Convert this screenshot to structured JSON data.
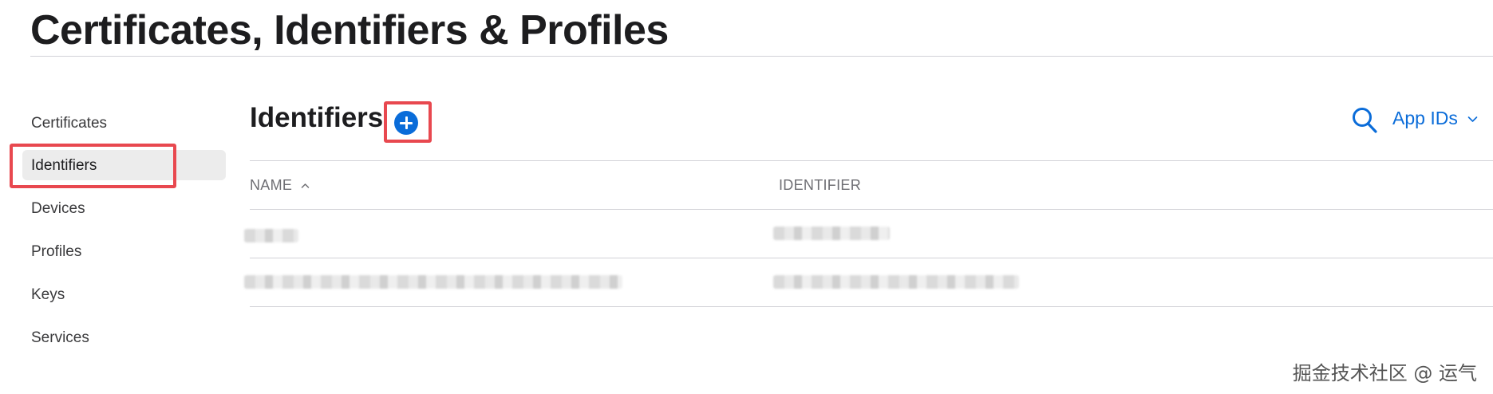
{
  "header": {
    "title": "Certificates, Identifiers & Profiles"
  },
  "sidebar": {
    "items": [
      {
        "label": "Certificates",
        "active": false
      },
      {
        "label": "Identifiers",
        "active": true
      },
      {
        "label": "Devices",
        "active": false
      },
      {
        "label": "Profiles",
        "active": false
      },
      {
        "label": "Keys",
        "active": false
      },
      {
        "label": "Services",
        "active": false
      }
    ]
  },
  "main": {
    "section_title": "Identifiers",
    "add_icon": "plus-circle-icon",
    "search_icon": "search-icon",
    "filter": {
      "selected": "App IDs",
      "icon": "chevron-down-icon"
    },
    "table": {
      "columns": [
        {
          "label": "NAME",
          "sort": "ascending"
        },
        {
          "label": "IDENTIFIER"
        }
      ],
      "rows": [
        {
          "name": "",
          "identifier": "",
          "redacted": true
        },
        {
          "name": "",
          "identifier": "",
          "redacted": true
        }
      ]
    }
  },
  "watermark": "掘金技术社区 @ 运气",
  "colors": {
    "accent": "#0a6cd9",
    "highlight": "#e8484f",
    "active_bg": "#ececec"
  }
}
